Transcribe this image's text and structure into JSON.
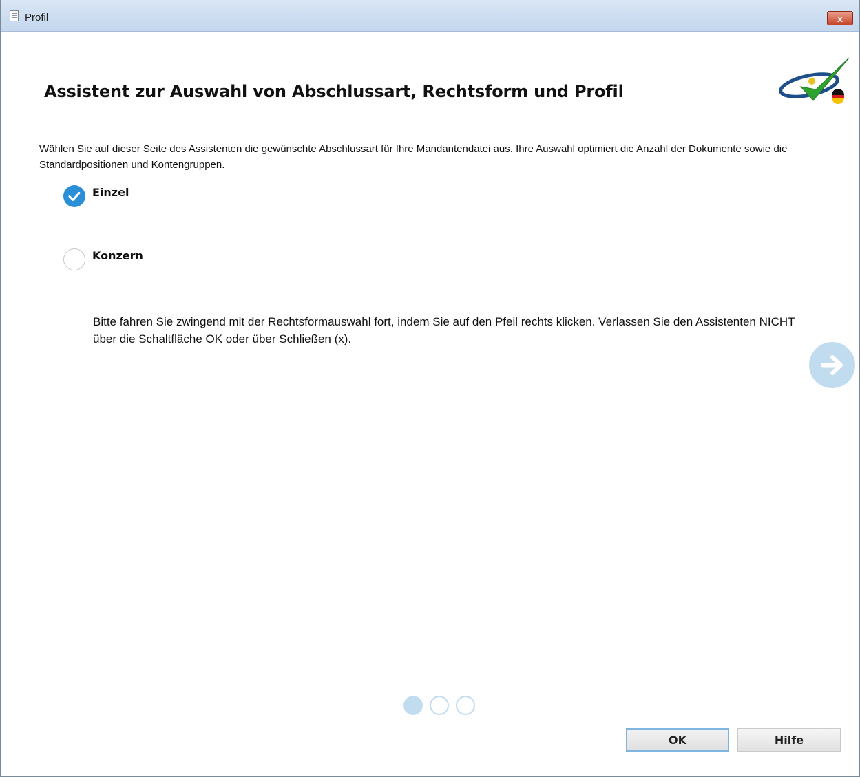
{
  "window": {
    "title": "Profil",
    "close_label": "x"
  },
  "header": {
    "heading": "Assistent zur Auswahl von Abschlussart, Rechtsform und Profil"
  },
  "intro_text": "Wählen Sie auf dieser Seite des Assistenten die gewünschte Abschlussart für Ihre Mandantendatei aus. Ihre Auswahl optimiert die Anzahl der Dokumente sowie die Standardpositionen und Kontengruppen.",
  "options": [
    {
      "label": "Einzel",
      "selected": true
    },
    {
      "label": "Konzern",
      "selected": false
    }
  ],
  "notice_text": "Bitte fahren Sie zwingend mit der Rechtsformauswahl fort, indem Sie auf den Pfeil rechts klicken. Verlassen Sie den Assistenten NICHT über die Schaltfläche OK oder über Schließen (x).",
  "pager": {
    "current_page": 1,
    "total_pages": 3
  },
  "buttons": {
    "ok_label": "OK",
    "help_label": "Hilfe"
  },
  "colors": {
    "accent": "#2a8fd6",
    "accent_light": "#c2dcef",
    "titlebar": "#c4d7ee",
    "close": "#c7442a"
  },
  "icons": {
    "title": "document-icon",
    "close": "close-icon",
    "logo": "checkmark-logo-icon",
    "selected": "checkmark-circle-icon",
    "next": "arrow-right-icon"
  }
}
